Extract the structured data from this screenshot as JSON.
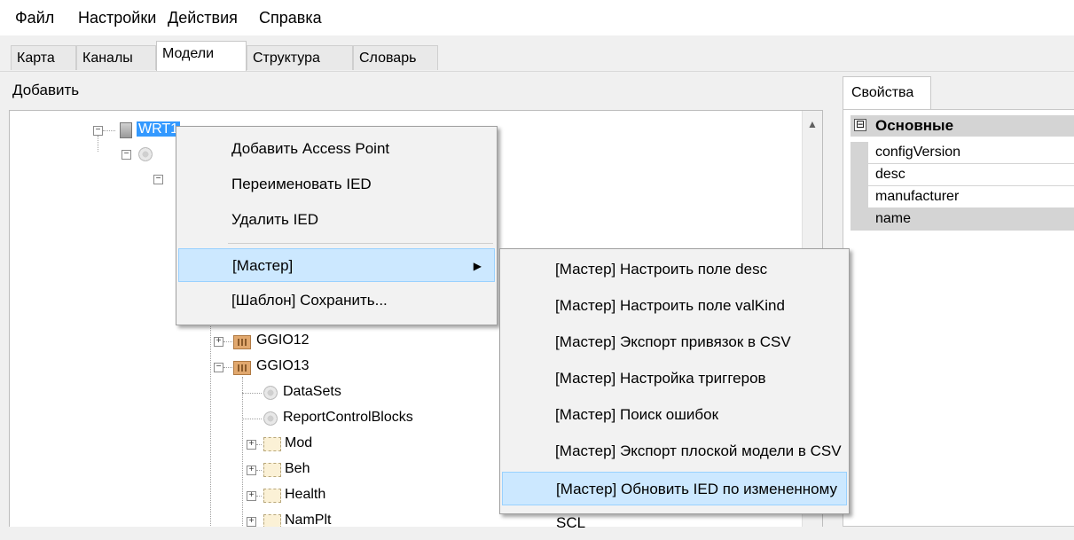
{
  "menubar": [
    "Файл",
    "Настройки",
    "Действия",
    "Справка"
  ],
  "tabs": [
    "Карта",
    "Каналы",
    "Модели",
    "Структура",
    "Словарь"
  ],
  "active_tab": "Модели",
  "left": {
    "add_label": "Добавить"
  },
  "tree": {
    "root_label": "WRT1",
    "nodes": [
      "GGIO12",
      "GGIO13",
      "DataSets",
      "ReportControlBlocks",
      "Mod",
      "Beh",
      "Health",
      "NamPlt"
    ]
  },
  "context_menu": {
    "items": [
      "Добавить Access Point",
      "Переименовать IED",
      "Удалить IED",
      "[Мастер]",
      "[Шаблон] Сохранить..."
    ]
  },
  "submenu": {
    "items": [
      "[Мастер] Настроить поле desc",
      "[Мастер] Настроить поле valKind",
      "[Мастер] Экспорт привязок в CSV",
      "[Мастер] Настройка триггеров",
      "[Мастер] Поиск ошибок",
      "[Мастер] Экспорт плоской модели в CSV",
      "[Мастер] Обновить IED по измененному SCL"
    ]
  },
  "properties": {
    "tab_label": "Свойства",
    "category": "Основные",
    "collapse_glyph": "⊟",
    "rows": [
      "configVersion",
      "desc",
      "manufacturer",
      "name"
    ]
  },
  "icons": {
    "expand_plus": "+",
    "expand_minus": "−",
    "submenu_arrow": "▶",
    "scroll_up": "▲"
  },
  "colors": {
    "selection": "#3399ff",
    "menu_highlight": "#cce8ff",
    "ln_icon": "#e1a86e"
  }
}
